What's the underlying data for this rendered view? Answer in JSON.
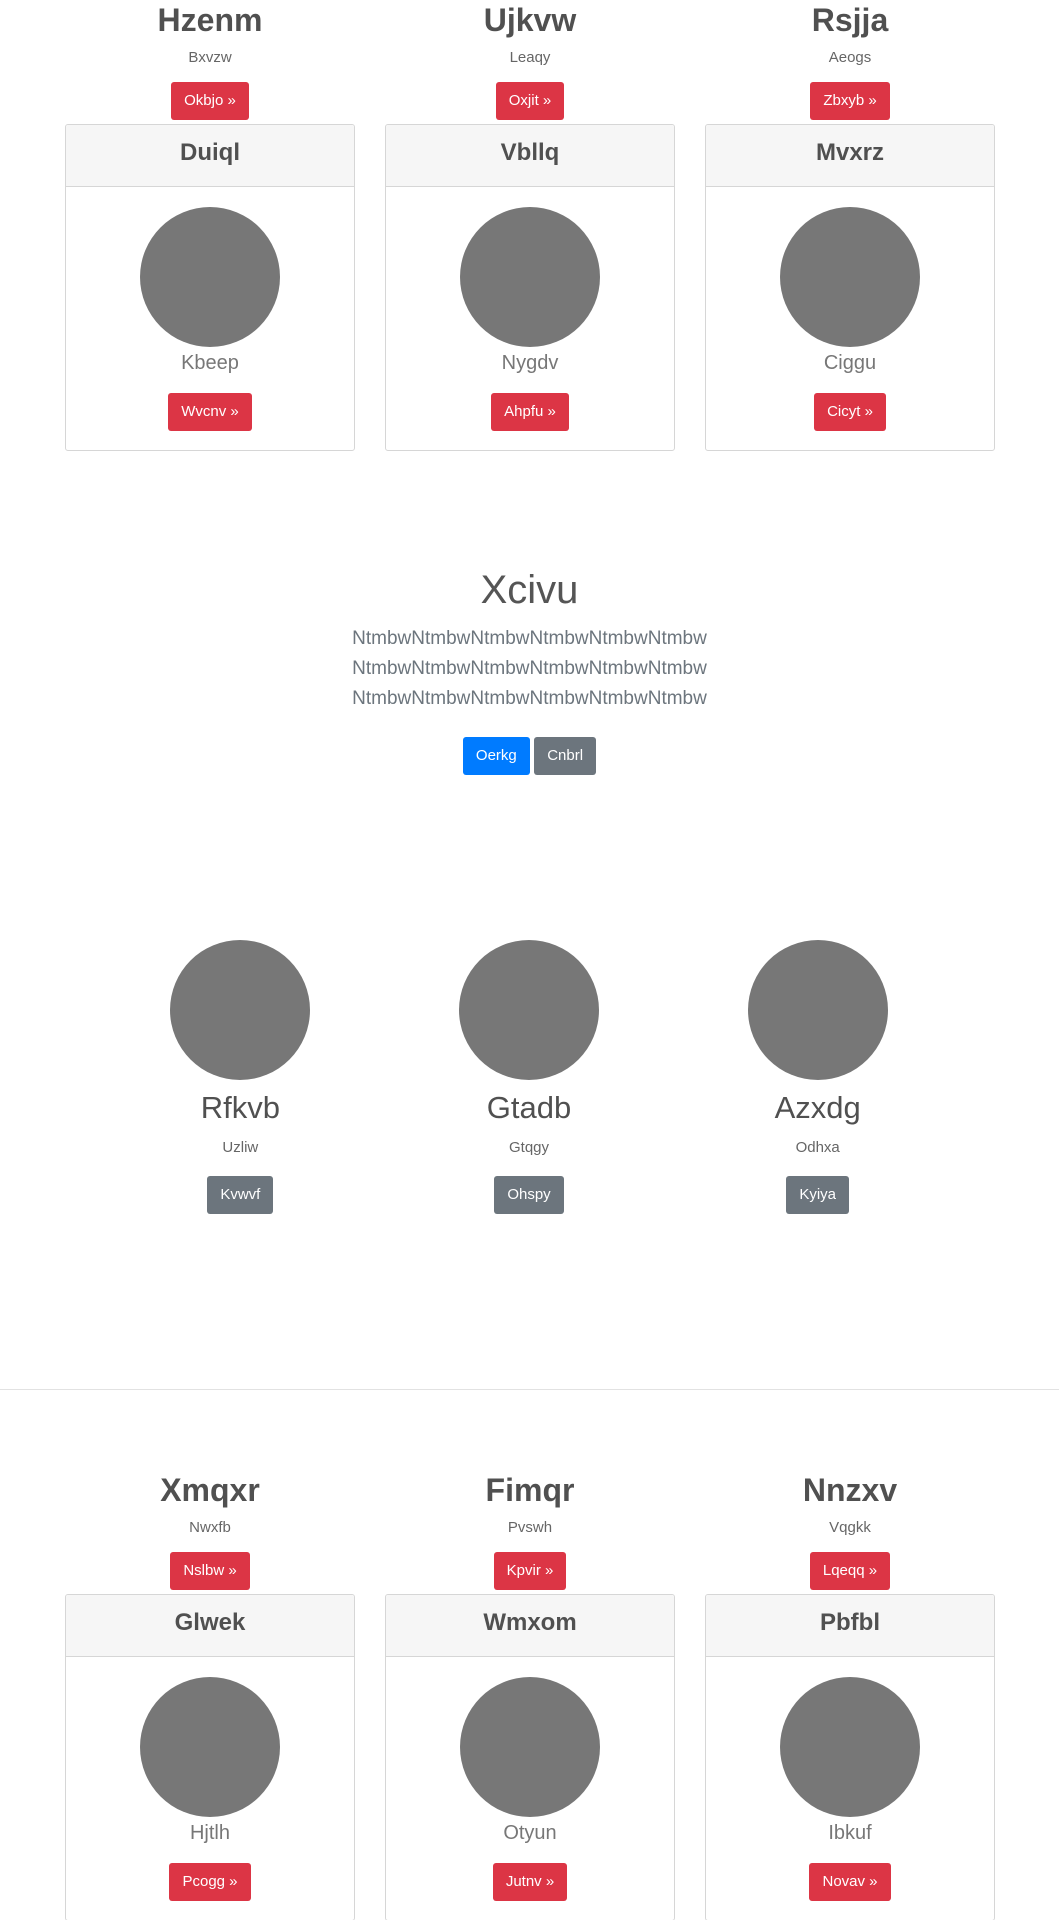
{
  "section1": {
    "headlines": [
      {
        "title": "Hzenm",
        "subtitle": "Bxvzw",
        "button": "Okbjo »"
      },
      {
        "title": "Ujkvw",
        "subtitle": "Leaqy",
        "button": "Oxjit »"
      },
      {
        "title": "Rsjja",
        "subtitle": "Aeogs",
        "button": "Zbxyb »"
      }
    ],
    "cards": [
      {
        "header": "Duiql",
        "name": "Kbeep",
        "button": "Wvcnv »"
      },
      {
        "header": "Vbllq",
        "name": "Nygdv",
        "button": "Ahpfu »"
      },
      {
        "header": "Mvxrz",
        "name": "Ciggu",
        "button": "Cicyt »"
      }
    ]
  },
  "hero": {
    "title": "Xcivu",
    "lines": [
      "NtmbwNtmbwNtmbwNtmbwNtmbwNtmbw",
      "NtmbwNtmbwNtmbwNtmbwNtmbwNtmbw",
      "NtmbwNtmbwNtmbwNtmbwNtmbwNtmbw"
    ],
    "primary_button": "Oerkg",
    "secondary_button": "Cnbrl"
  },
  "team": [
    {
      "name": "Rfkvb",
      "subtitle": "Uzliw",
      "button": "Kvwvf"
    },
    {
      "name": "Gtadb",
      "subtitle": "Gtqgy",
      "button": "Ohspy"
    },
    {
      "name": "Azxdg",
      "subtitle": "Odhxa",
      "button": "Kyiya"
    }
  ],
  "section2": {
    "headlines": [
      {
        "title": "Xmqxr",
        "subtitle": "Nwxfb",
        "button": "Nslbw »"
      },
      {
        "title": "Fimqr",
        "subtitle": "Pvswh",
        "button": "Kpvir »"
      },
      {
        "title": "Nnzxv",
        "subtitle": "Vqgkk",
        "button": "Lqeqq »"
      }
    ],
    "cards": [
      {
        "header": "Glwek",
        "name": "Hjtlh",
        "button": "Pcogg »"
      },
      {
        "header": "Wmxom",
        "name": "Otyun",
        "button": "Jutnv »"
      },
      {
        "header": "Pbfbl",
        "name": "Ibkuf",
        "button": "Novav »"
      }
    ]
  },
  "colors": {
    "danger": "#dc3545",
    "primary": "#007bff",
    "secondary": "#6c757d",
    "avatar_placeholder": "#777777"
  }
}
